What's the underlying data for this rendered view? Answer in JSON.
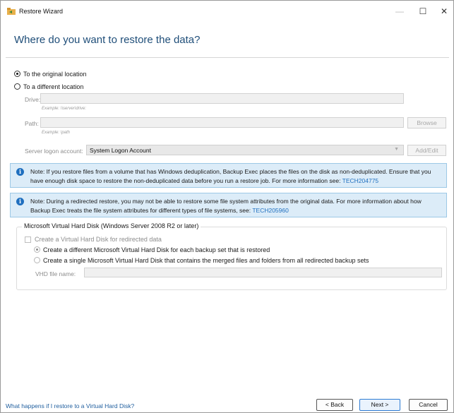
{
  "window": {
    "title": "Restore Wizard",
    "controls": {
      "minimize": "—",
      "maximize": "☐",
      "close": "✕"
    }
  },
  "heading": "Where do you want to restore the data?",
  "location": {
    "original_label": "To the original location",
    "different_label": "To a different location",
    "selected": "original"
  },
  "drive": {
    "label": "Drive:",
    "value": "",
    "example": "Example: \\\\server\\drive:"
  },
  "path": {
    "label": "Path:",
    "value": "",
    "example": "Example: \\path",
    "browse_label": "Browse"
  },
  "logon": {
    "label": "Server logon account:",
    "value": "System Logon Account",
    "add_edit_label": "Add/Edit"
  },
  "notes": [
    {
      "icon": "info-icon",
      "text": "Note: If you restore files from a volume that has Windows deduplication, Backup Exec places the files on the disk as non-deduplicated. Ensure that you have enough disk space to restore the non-deduplicated data before you run a restore job. For more information see: ",
      "link": "TECH204775"
    },
    {
      "icon": "info-icon",
      "text": "Note: During a redirected restore, you may not be able to restore some file system attributes from the original data. For more information about how Backup Exec treats the file system attributes for different types of file systems, see: ",
      "link": "TECH205960"
    }
  ],
  "vhd": {
    "group_title": "Microsoft Virtual Hard Disk (Windows Server 2008 R2 or later)",
    "checkbox_label": "Create a Virtual Hard Disk for redirected data",
    "checkbox_checked": false,
    "option_each": "Create a different Microsoft Virtual Hard Disk for each backup set that is restored",
    "option_single": "Create a single Microsoft Virtual Hard Disk that contains the merged files and folders from all redirected backup sets",
    "selected_option": "each",
    "file_name_label": "VHD file name:",
    "file_name_value": ""
  },
  "footer": {
    "help_link": "What happens if I restore to a Virtual Hard Disk?",
    "back_label": "< Back",
    "next_label": "Next >",
    "cancel_label": "Cancel"
  },
  "colors": {
    "heading": "#1f4e79",
    "note_bg": "#dcecf8",
    "link": "#1f6fbf",
    "primary_border": "#2d7bd3"
  }
}
